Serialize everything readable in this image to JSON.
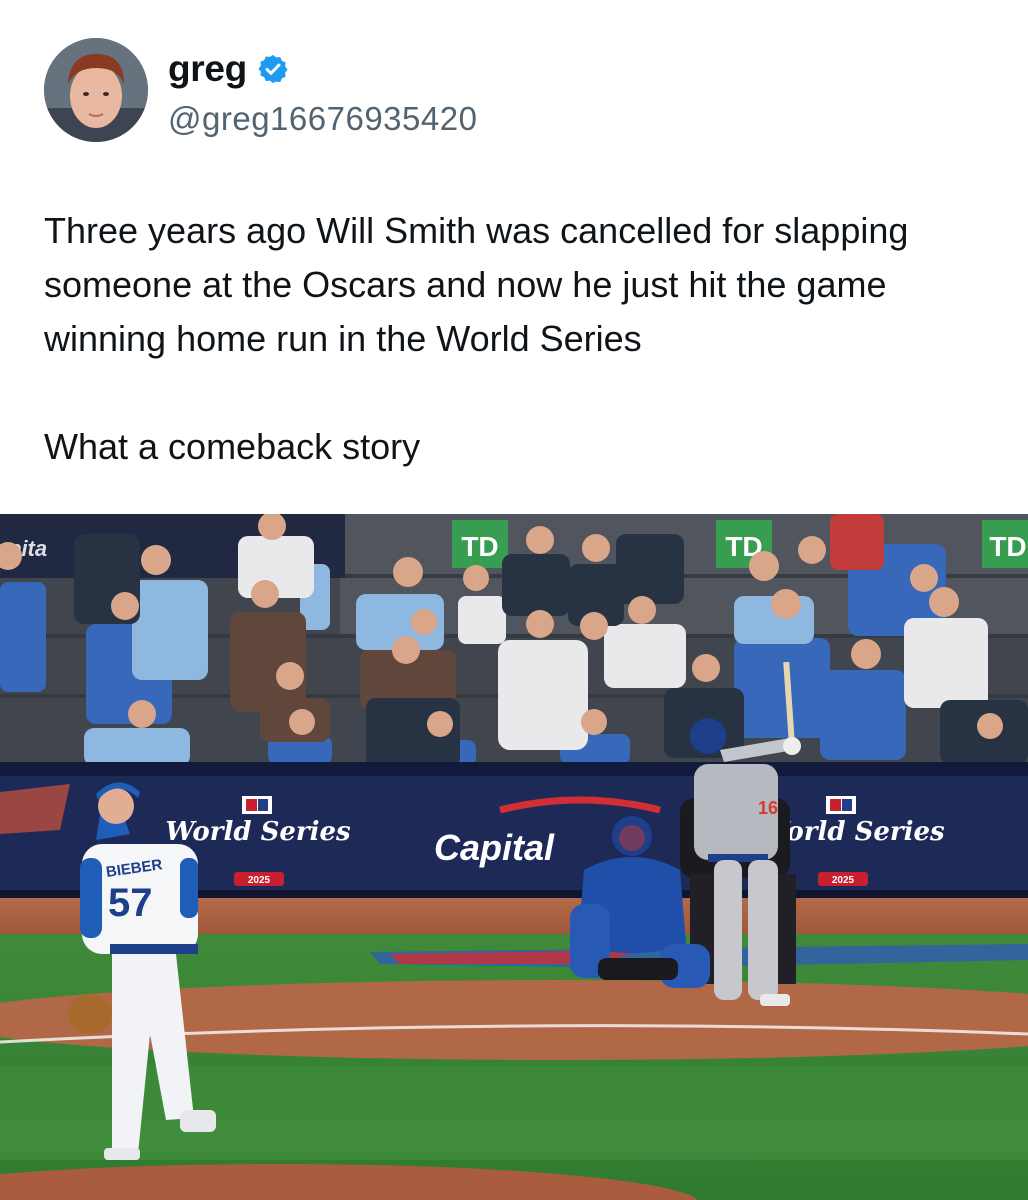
{
  "author": {
    "display_name": "greg",
    "handle": "@greg16676935420",
    "verified": true,
    "verified_icon": "verified-badge-icon",
    "accent_color": "#1d9bf0"
  },
  "post": {
    "paragraphs": [
      "Three years ago Will Smith was cancelled for slapping someone at the Oscars and now he just hit the game winning home run in the World Series",
      "What a comeback story"
    ]
  },
  "media": {
    "signage": {
      "sponsor_partial": "pita",
      "td": "TD",
      "world_series": "World Series",
      "capital_one": "Capital",
      "year": "2025"
    },
    "jerseys": {
      "pitcher_name": "BIEBER",
      "pitcher_number": "57",
      "batter_number": "16"
    }
  }
}
